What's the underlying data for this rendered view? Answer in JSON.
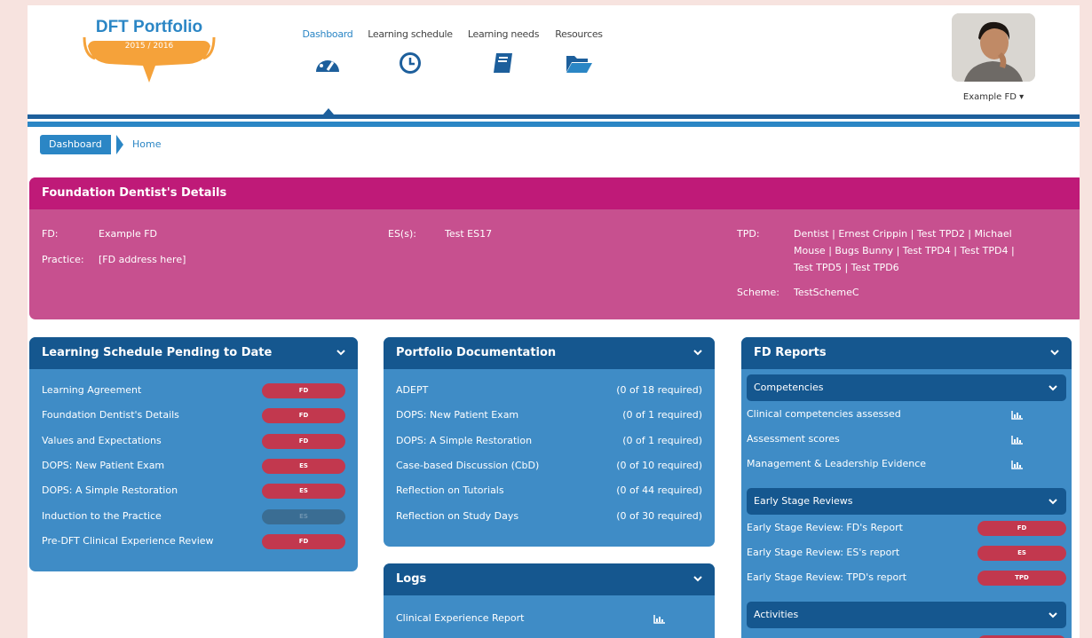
{
  "logo": {
    "title": "DFT Portfolio",
    "year": "2015 / 2016"
  },
  "nav": [
    {
      "label": "Dashboard",
      "icon": "dashboard-gauge-icon",
      "active": true
    },
    {
      "label": "Learning schedule",
      "icon": "clock-icon",
      "active": false
    },
    {
      "label": "Learning needs",
      "icon": "book-icon",
      "active": false
    },
    {
      "label": "Resources",
      "icon": "folder-open-icon",
      "active": false
    }
  ],
  "profile": {
    "name": "Example FD ▾"
  },
  "breadcrumb": {
    "active": "Dashboard",
    "home": "Home"
  },
  "fd_details": {
    "title": "Foundation Dentist's Details",
    "fd_label": "FD:",
    "fd_value": "Example FD",
    "practice_label": "Practice:",
    "practice_value": "[FD address here]",
    "es_label": "ES(s):",
    "es_value": "Test ES17",
    "tpd_label": "TPD:",
    "tpd_lines": [
      "Dentist | Ernest Crippin | Test TPD2 | Michael",
      "Mouse | Bugs Bunny | Test TPD4 | Test TPD4 |",
      "Test TPD5 | Test TPD6"
    ],
    "scheme_label": "Scheme:",
    "scheme_value": "TestSchemeC"
  },
  "learning_schedule": {
    "title": "Learning Schedule Pending to Date",
    "items": [
      {
        "label": "Learning Agreement",
        "badge": "FD",
        "muted": false
      },
      {
        "label": "Foundation Dentist's Details",
        "badge": "FD",
        "muted": false
      },
      {
        "label": "Values and Expectations",
        "badge": "FD",
        "muted": false
      },
      {
        "label": "DOPS: New Patient Exam",
        "badge": "ES",
        "muted": false
      },
      {
        "label": "DOPS: A Simple Restoration",
        "badge": "ES",
        "muted": false
      },
      {
        "label": "Induction to the Practice",
        "badge": "ES",
        "muted": true
      },
      {
        "label": "Pre-DFT Clinical Experience Review",
        "badge": "FD",
        "muted": false
      }
    ]
  },
  "portfolio": {
    "title": "Portfolio Documentation",
    "items": [
      {
        "label": "ADEPT",
        "req": "(0 of 18 required)"
      },
      {
        "label": "DOPS: New Patient Exam",
        "req": "(0 of 1 required)"
      },
      {
        "label": "DOPS: A Simple Restoration",
        "req": "(0 of 1 required)"
      },
      {
        "label": "Case-based Discussion (CbD)",
        "req": "(0 of 10 required)"
      },
      {
        "label": "Reflection on Tutorials",
        "req": "(0 of 44 required)"
      },
      {
        "label": "Reflection on Study Days",
        "req": "(0 of 30 required)"
      }
    ]
  },
  "logs": {
    "title": "Logs",
    "items": [
      {
        "label": "Clinical Experience Report",
        "icon": "bar-chart-icon"
      }
    ]
  },
  "fd_reports": {
    "title": "FD Reports",
    "competencies": {
      "title": "Competencies",
      "items": [
        {
          "label": "Clinical competencies assessed",
          "icon": "bar-chart-icon"
        },
        {
          "label": "Assessment scores",
          "icon": "bar-chart-icon"
        },
        {
          "label": "Management & Leadership Evidence",
          "icon": "bar-chart-icon"
        }
      ]
    },
    "early_stage": {
      "title": "Early Stage Reviews",
      "items": [
        {
          "label": "Early Stage Review: FD's Report",
          "badge": "FD"
        },
        {
          "label": "Early Stage Review: ES's report",
          "badge": "ES"
        },
        {
          "label": "Early Stage Review: TPD's report",
          "badge": "TPD"
        }
      ]
    },
    "activities": {
      "title": "Activities"
    }
  },
  "colors": {
    "primary_blue": "#2b86c5",
    "dark_blue": "#15578f",
    "card_blue": "#3f8cc6",
    "magenta": "#bf1a78",
    "pink_panel": "#c7508f",
    "badge_red": "#c2384e",
    "logo_orange": "#f5a23a"
  }
}
